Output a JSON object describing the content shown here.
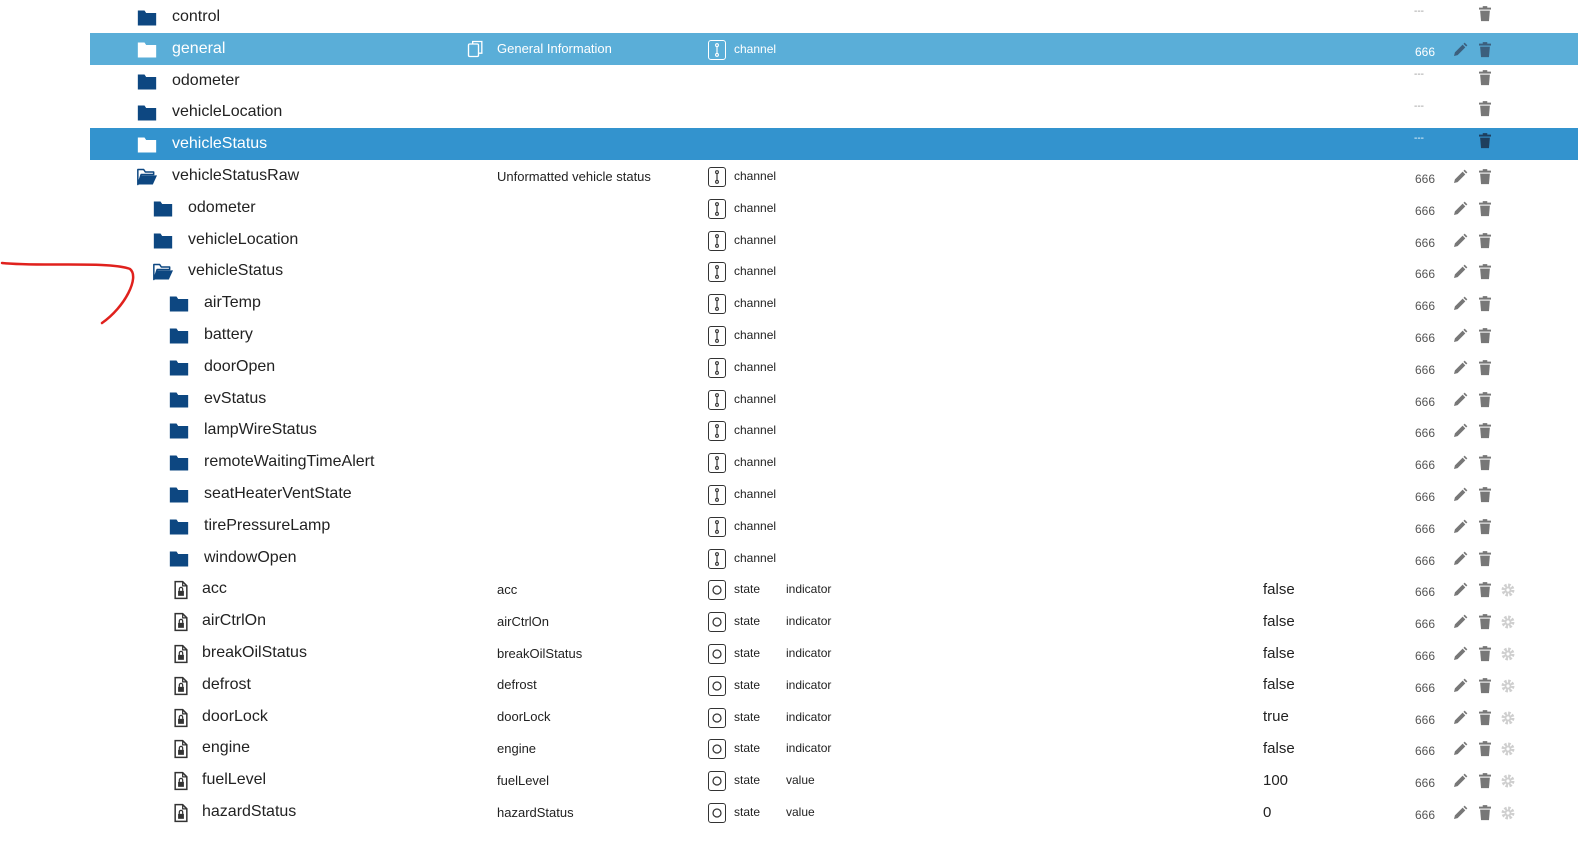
{
  "colors": {
    "folder": "#0d4781",
    "highlight_light": "#5aaed8",
    "highlight_dark": "#3393ce",
    "annotation": "#e0211d",
    "action_gray": "#777777",
    "gear_light": "#cfcfcf"
  },
  "icons": {
    "folder_closed": "folder-icon",
    "folder_open": "folder-open-icon",
    "state_file": "file-lock-icon",
    "channel_role": "channel-icon",
    "state_role": "state-icon",
    "copy": "copy-icon",
    "edit": "pencil-icon",
    "delete": "trash-icon",
    "settings": "gear-icon"
  },
  "rows": [
    {
      "name": "control",
      "kind": "folder",
      "level": 0,
      "label": "",
      "type": "",
      "role": "",
      "value": "",
      "acl": "---",
      "edit": false,
      "gear": false,
      "highlight": ""
    },
    {
      "name": "general",
      "kind": "folder",
      "level": 0,
      "label": "General Information",
      "type": "channel",
      "role": "",
      "value": "",
      "acl": "666",
      "edit": true,
      "gear": false,
      "highlight": "light",
      "copy": true
    },
    {
      "name": "odometer",
      "kind": "folder",
      "level": 0,
      "label": "",
      "type": "",
      "role": "",
      "value": "",
      "acl": "---",
      "edit": false,
      "gear": false,
      "highlight": ""
    },
    {
      "name": "vehicleLocation",
      "kind": "folder",
      "level": 0,
      "label": "",
      "type": "",
      "role": "",
      "value": "",
      "acl": "---",
      "edit": false,
      "gear": false,
      "highlight": ""
    },
    {
      "name": "vehicleStatus",
      "kind": "folder",
      "level": 0,
      "label": "",
      "type": "",
      "role": "",
      "value": "",
      "acl": "---",
      "edit": false,
      "gear": false,
      "highlight": "dark"
    },
    {
      "name": "vehicleStatusRaw",
      "kind": "folder-open",
      "level": 0,
      "label": "Unformatted vehicle status",
      "type": "channel",
      "role": "",
      "value": "",
      "acl": "666",
      "edit": true,
      "gear": false,
      "highlight": ""
    },
    {
      "name": "odometer",
      "kind": "folder",
      "level": 1,
      "label": "",
      "type": "channel",
      "role": "",
      "value": "",
      "acl": "666",
      "edit": true,
      "gear": false,
      "highlight": ""
    },
    {
      "name": "vehicleLocation",
      "kind": "folder",
      "level": 1,
      "label": "",
      "type": "channel",
      "role": "",
      "value": "",
      "acl": "666",
      "edit": true,
      "gear": false,
      "highlight": ""
    },
    {
      "name": "vehicleStatus",
      "kind": "folder-open",
      "level": 1,
      "label": "",
      "type": "channel",
      "role": "",
      "value": "",
      "acl": "666",
      "edit": true,
      "gear": false,
      "highlight": ""
    },
    {
      "name": "airTemp",
      "kind": "folder",
      "level": 2,
      "label": "",
      "type": "channel",
      "role": "",
      "value": "",
      "acl": "666",
      "edit": true,
      "gear": false,
      "highlight": ""
    },
    {
      "name": "battery",
      "kind": "folder",
      "level": 2,
      "label": "",
      "type": "channel",
      "role": "",
      "value": "",
      "acl": "666",
      "edit": true,
      "gear": false,
      "highlight": ""
    },
    {
      "name": "doorOpen",
      "kind": "folder",
      "level": 2,
      "label": "",
      "type": "channel",
      "role": "",
      "value": "",
      "acl": "666",
      "edit": true,
      "gear": false,
      "highlight": ""
    },
    {
      "name": "evStatus",
      "kind": "folder",
      "level": 2,
      "label": "",
      "type": "channel",
      "role": "",
      "value": "",
      "acl": "666",
      "edit": true,
      "gear": false,
      "highlight": ""
    },
    {
      "name": "lampWireStatus",
      "kind": "folder",
      "level": 2,
      "label": "",
      "type": "channel",
      "role": "",
      "value": "",
      "acl": "666",
      "edit": true,
      "gear": false,
      "highlight": ""
    },
    {
      "name": "remoteWaitingTimeAlert",
      "kind": "folder",
      "level": 2,
      "label": "",
      "type": "channel",
      "role": "",
      "value": "",
      "acl": "666",
      "edit": true,
      "gear": false,
      "highlight": ""
    },
    {
      "name": "seatHeaterVentState",
      "kind": "folder",
      "level": 2,
      "label": "",
      "type": "channel",
      "role": "",
      "value": "",
      "acl": "666",
      "edit": true,
      "gear": false,
      "highlight": ""
    },
    {
      "name": "tirePressureLamp",
      "kind": "folder",
      "level": 2,
      "label": "",
      "type": "channel",
      "role": "",
      "value": "",
      "acl": "666",
      "edit": true,
      "gear": false,
      "highlight": ""
    },
    {
      "name": "windowOpen",
      "kind": "folder",
      "level": 2,
      "label": "",
      "type": "channel",
      "role": "",
      "value": "",
      "acl": "666",
      "edit": true,
      "gear": false,
      "highlight": ""
    },
    {
      "name": "acc",
      "kind": "state",
      "level": 2,
      "label": "acc",
      "type": "state",
      "role": "indicator",
      "value": "false",
      "acl": "666",
      "edit": true,
      "gear": true,
      "highlight": ""
    },
    {
      "name": "airCtrlOn",
      "kind": "state",
      "level": 2,
      "label": "airCtrlOn",
      "type": "state",
      "role": "indicator",
      "value": "false",
      "acl": "666",
      "edit": true,
      "gear": true,
      "highlight": ""
    },
    {
      "name": "breakOilStatus",
      "kind": "state",
      "level": 2,
      "label": "breakOilStatus",
      "type": "state",
      "role": "indicator",
      "value": "false",
      "acl": "666",
      "edit": true,
      "gear": true,
      "highlight": ""
    },
    {
      "name": "defrost",
      "kind": "state",
      "level": 2,
      "label": "defrost",
      "type": "state",
      "role": "indicator",
      "value": "false",
      "acl": "666",
      "edit": true,
      "gear": true,
      "highlight": ""
    },
    {
      "name": "doorLock",
      "kind": "state",
      "level": 2,
      "label": "doorLock",
      "type": "state",
      "role": "indicator",
      "value": "true",
      "acl": "666",
      "edit": true,
      "gear": true,
      "highlight": ""
    },
    {
      "name": "engine",
      "kind": "state",
      "level": 2,
      "label": "engine",
      "type": "state",
      "role": "indicator",
      "value": "false",
      "acl": "666",
      "edit": true,
      "gear": true,
      "highlight": ""
    },
    {
      "name": "fuelLevel",
      "kind": "state",
      "level": 2,
      "label": "fuelLevel",
      "type": "state",
      "role": "value",
      "value": "100",
      "acl": "666",
      "edit": true,
      "gear": true,
      "highlight": ""
    },
    {
      "name": "hazardStatus",
      "kind": "state",
      "level": 2,
      "label": "hazardStatus",
      "type": "state",
      "role": "value",
      "value": "0",
      "acl": "666",
      "edit": true,
      "gear": true,
      "highlight": ""
    }
  ]
}
